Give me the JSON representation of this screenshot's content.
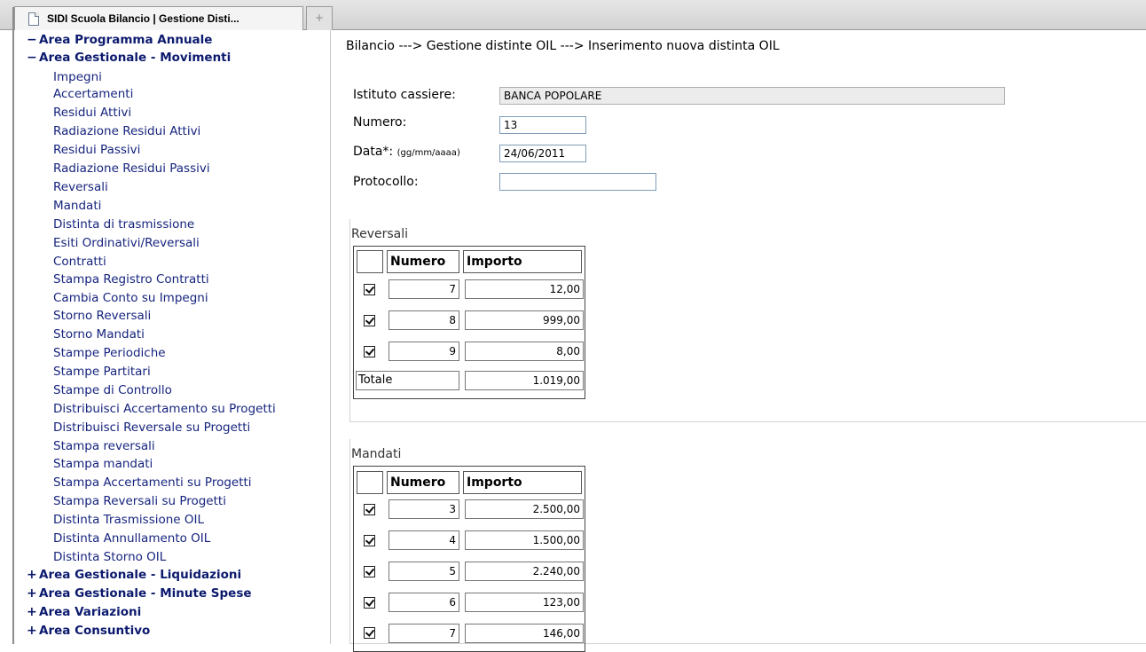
{
  "browser": {
    "tab_title": "SIDI Scuola Bilancio | Gestione Disti...",
    "new_tab_symbol": "+"
  },
  "sidebar": {
    "sections_top": [
      {
        "toggle": "−",
        "label": "Area Programma Annuale"
      },
      {
        "toggle": "−",
        "label": "Area Gestionale - Movimenti"
      }
    ],
    "items": [
      "Impegni",
      "Accertamenti",
      "Residui Attivi",
      "Radiazione Residui Attivi",
      "Residui Passivi",
      "Radiazione Residui Passivi",
      "Reversali",
      "Mandati",
      "Distinta di trasmissione",
      "Esiti Ordinativi/Reversali",
      "Contratti",
      "Stampa Registro Contratti",
      "Cambia Conto su Impegni",
      "Storno Reversali",
      "Storno Mandati",
      "Stampe Periodiche",
      "Stampe Partitari",
      "Stampe di Controllo",
      "Distribuisci Accertamento su Progetti",
      "Distribuisci Reversale su Progetti",
      "Stampa reversali",
      "Stampa mandati",
      "Stampa Accertamenti su Progetti",
      "Stampa Reversali su Progetti",
      "Distinta Trasmissione OIL",
      "Distinta Annullamento OIL",
      "Distinta Storno OIL"
    ],
    "sections_bottom": [
      {
        "toggle": "+",
        "label": "Area Gestionale - Liquidazioni"
      },
      {
        "toggle": "+",
        "label": "Area Gestionale - Minute Spese"
      },
      {
        "toggle": "+",
        "label": "Area Variazioni"
      },
      {
        "toggle": "+",
        "label": "Area Consuntivo"
      }
    ]
  },
  "main": {
    "breadcrumb": "Bilancio ---> Gestione distinte OIL ---> Inserimento nuova distinta OIL",
    "form": {
      "istituto_label": "Istituto cassiere:",
      "istituto_value": "BANCA POPOLARE",
      "numero_label": "Numero:",
      "numero_value": "13",
      "data_label": "Data*:",
      "data_hint": "(gg/mm/aaaa)",
      "data_value": "24/06/2011",
      "protocollo_label": "Protocollo:",
      "protocollo_value": ""
    },
    "reversali": {
      "title": "Reversali",
      "col_numero": "Numero",
      "col_importo": "Importo",
      "rows": [
        {
          "checked": true,
          "numero": "7",
          "importo": "12,00"
        },
        {
          "checked": true,
          "numero": "8",
          "importo": "999,00"
        },
        {
          "checked": true,
          "numero": "9",
          "importo": "8,00"
        }
      ],
      "totale_label": "Totale",
      "totale_value": "1.019,00"
    },
    "mandati": {
      "title": "Mandati",
      "col_numero": "Numero",
      "col_importo": "Importo",
      "rows": [
        {
          "checked": true,
          "numero": "3",
          "importo": "2.500,00"
        },
        {
          "checked": true,
          "numero": "4",
          "importo": "1.500,00"
        },
        {
          "checked": true,
          "numero": "5",
          "importo": "2.240,00"
        },
        {
          "checked": true,
          "numero": "6",
          "importo": "123,00"
        },
        {
          "checked": true,
          "numero": "7",
          "importo": "146,00"
        }
      ]
    }
  }
}
